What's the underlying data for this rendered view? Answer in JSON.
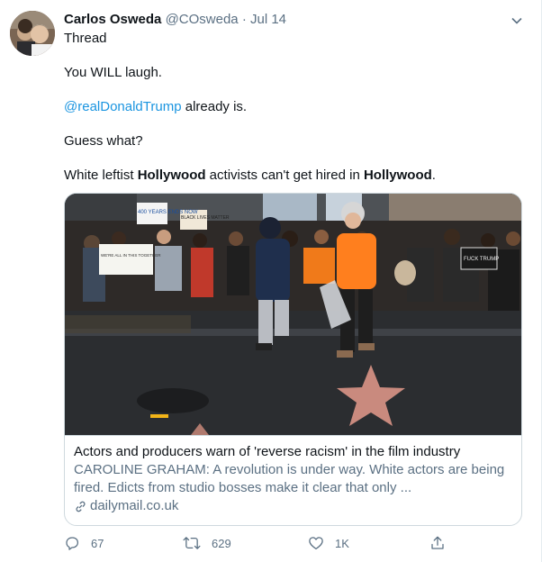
{
  "tweet": {
    "author_name": "Carlos Osweda",
    "author_handle": "@COsweda",
    "separator": "·",
    "date": "Jul 14",
    "lines": {
      "thread": "Thread",
      "laugh": "You WILL laugh.",
      "mention": "@realDonaldTrump",
      "already": " already is.",
      "guess": "Guess what?",
      "p4_a": "White leftist ",
      "p4_b": "Hollywood",
      "p4_c": " activists can't get hired in ",
      "p4_d": "Hollywood",
      "p4_e": "."
    }
  },
  "card": {
    "title": "Actors and producers warn of 'reverse racism' in the film industry",
    "description": "CAROLINE GRAHAM: A revolution is under way. White actors are being fired. Edicts from studio bosses make it clear that only ...",
    "domain": "dailymail.co.uk"
  },
  "photo_signs": {
    "sign1": "400 YEARS ENDS NOW",
    "sign2": "BLACK LIVES MATTER",
    "sign3": "WE'RE ALL IN THIS TOGETHER",
    "sign4": "FUCK TRUMP"
  },
  "actions": {
    "reply_count": "67",
    "retweet_count": "629",
    "like_count": "1K"
  },
  "icons": [
    "caret-down-icon",
    "link-icon",
    "reply-icon",
    "retweet-icon",
    "like-icon",
    "share-icon"
  ],
  "colors": {
    "link": "#1b95e0",
    "secondary_text": "#5b7083",
    "border": "#cfd9de"
  }
}
